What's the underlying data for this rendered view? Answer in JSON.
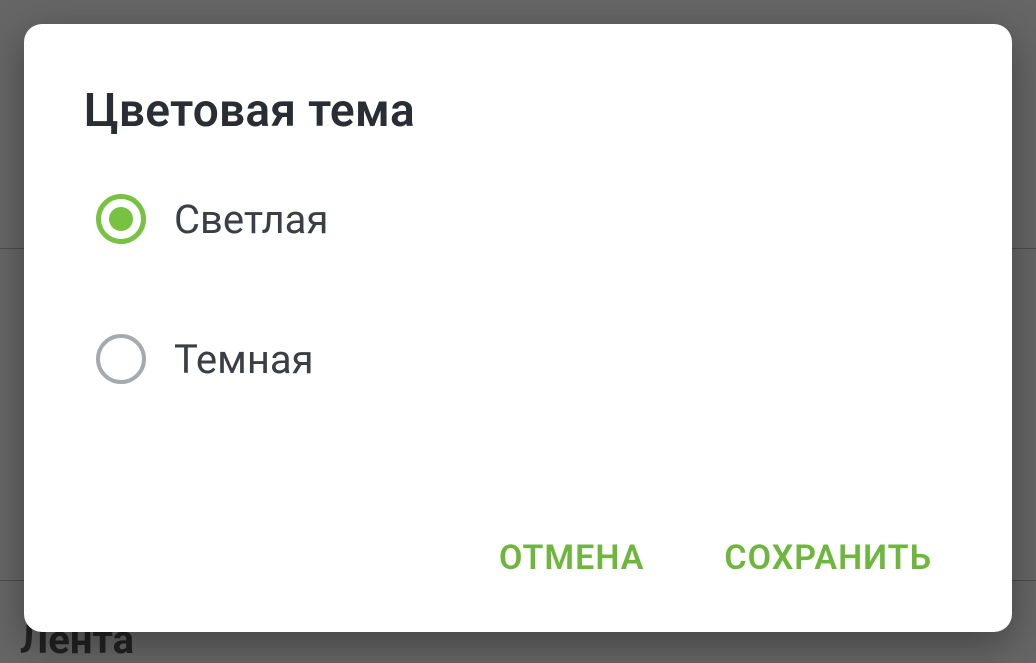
{
  "background": {
    "partial_text": "Лента"
  },
  "dialog": {
    "title": "Цветовая тема",
    "options": [
      {
        "label": "Светлая",
        "selected": true
      },
      {
        "label": "Темная",
        "selected": false
      }
    ],
    "actions": {
      "cancel": "ОТМЕНА",
      "save": "СОХРАНИТЬ"
    }
  },
  "colors": {
    "accent": "#77c241",
    "text_primary": "#2a2d33",
    "radio_unselected": "#a6a9ad"
  }
}
